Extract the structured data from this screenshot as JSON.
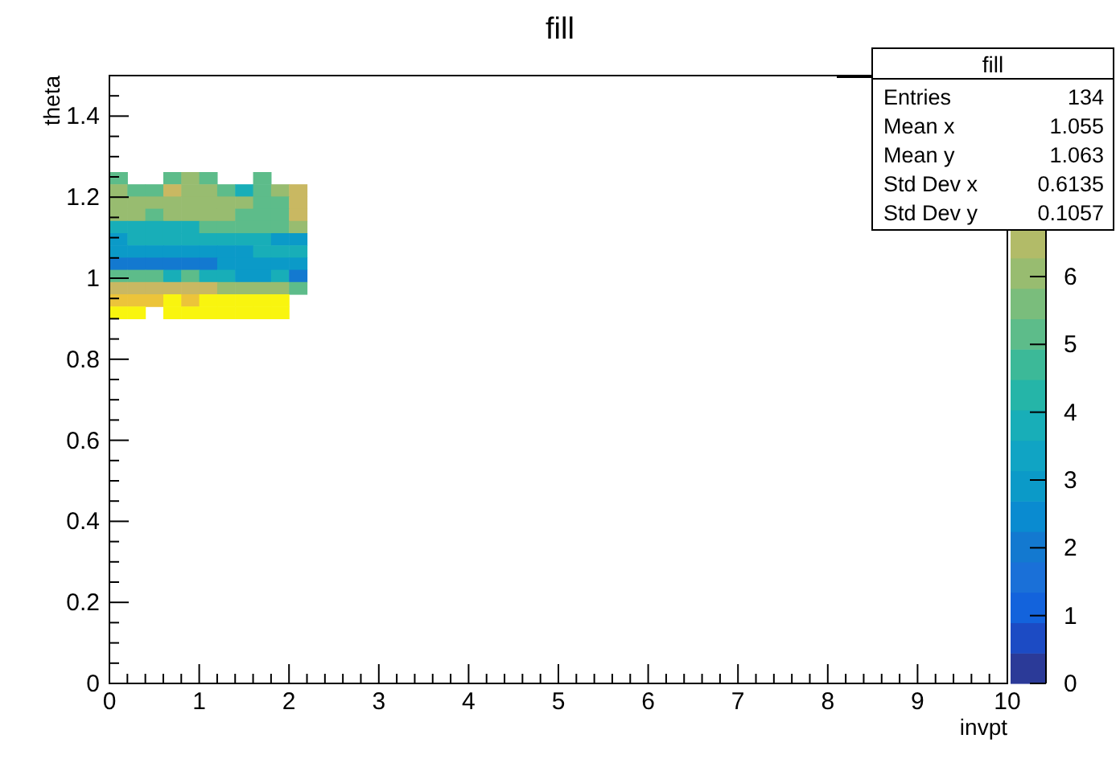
{
  "title": "fill",
  "plot": {
    "xlabel": "invpt",
    "ylabel": "theta",
    "xticks": [
      "0",
      "1",
      "2",
      "3",
      "4",
      "5",
      "6",
      "7",
      "8",
      "9",
      "10"
    ],
    "yticks": [
      "1.4",
      "1.2",
      "1",
      "0.8",
      "0.6",
      "0.4",
      "0.2",
      "0"
    ],
    "palette_ticks": [
      "6",
      "5",
      "4",
      "3",
      "2",
      "1",
      "0"
    ]
  },
  "stats": {
    "title": "fill",
    "rows": [
      {
        "label": "Entries",
        "value": "134"
      },
      {
        "label": "Mean x",
        "value": "1.055"
      },
      {
        "label": "Mean y",
        "value": "1.063"
      },
      {
        "label": "Std Dev x",
        "value": "0.6135"
      },
      {
        "label": "Std Dev y",
        "value": "0.1057"
      }
    ]
  }
}
